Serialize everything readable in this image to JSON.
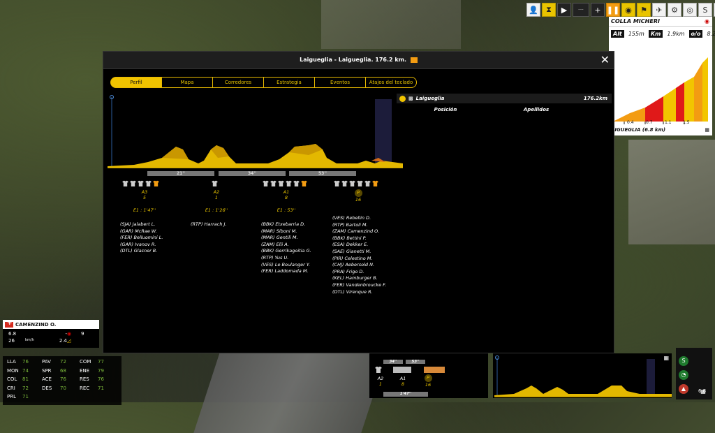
{
  "toolbar": {
    "icons": [
      "person-icon",
      "hourglass-icon",
      "play-icon",
      "fast-forward-icon",
      "plus-icon",
      "pause-icon",
      "eye-icon",
      "flag-icon",
      "bird-icon",
      "bicycle-icon",
      "stage-icon",
      "s-icon",
      "menu-icon",
      "info-icon"
    ],
    "dots": "····"
  },
  "mini_profile": {
    "title": "COLLA MICHERI",
    "alt_label": "Alt",
    "alt": "155m",
    "km_label": "Km",
    "km": "1.9km",
    "grade_label": "o/o",
    "grade": "8.2%",
    "ticks": [
      "0.4",
      "0.7",
      "1.1",
      "1.5"
    ],
    "bottom_label": "AIGUEGLIA (6.8 km)"
  },
  "modal": {
    "title": "Laigueglia - Laigueglia. 176.2 km.",
    "tabs": [
      "Perfil",
      "Mapa",
      "Corredores",
      "Estrategia",
      "Eventos",
      "Atajos del teclado"
    ],
    "active_tab": "Perfil",
    "segments": [
      {
        "label": "21''"
      },
      {
        "label": "34''"
      },
      {
        "label": "53''"
      }
    ],
    "groups": [
      {
        "climb": "A3",
        "count": "5",
        "gap": "E1 : 1'47''",
        "riders": [
          "(SJA) Jalabert L.",
          "(GAR) McRae W.",
          "(FER) Belluomini L.",
          "(GAR) Ivanov R.",
          "(DTL) Glasner B."
        ]
      },
      {
        "climb": "A2",
        "count": "1",
        "gap": "E1 : 1'26''",
        "riders": [
          "(RTP) Harrach J."
        ]
      },
      {
        "climb": "A1",
        "count": "8",
        "gap": "E1 : 53''",
        "riders": [
          "(BBK) Etxebarria D.",
          "(MAR) Siboni M.",
          "(MAR) Gentili M.",
          "(ZAM) Elli A.",
          "(BBK) Gerrikagoitia G.",
          "(RTP) Yus U.",
          "(VES) Le Boulanger Y.",
          "(FER) Laddomada M."
        ]
      },
      {
        "climb": "P",
        "count": "16",
        "gap": "",
        "riders": [
          "(VES) Rebellin D.",
          "(RTP) Bartoli M.",
          "(ZAM) Camenzind O.",
          "(BBK) Bettini P.",
          "(ESA) Dekker E.",
          "(SAE) Gianetti M.",
          "(PIR) Celestino M.",
          "(CHJ) Aebersold N.",
          "(PRA) Frigo D.",
          "(KEL) Hamburger B.",
          "(FER) Vandenbroucke F.",
          "(DTL) Virenque R."
        ]
      }
    ],
    "finish": {
      "name": "Laigueglia",
      "distance": "176.2km",
      "col_position": "Posición",
      "col_names": "Apellidos"
    }
  },
  "rider": {
    "name": "CAMENZIND O.",
    "speed1": "6.8",
    "dash1": "-",
    "val3": "9",
    "speed2": "26",
    "unit": "km/h",
    "grade": "2.4",
    "attributes": [
      [
        "LLA",
        "76",
        "PAV",
        "72",
        "COM",
        "77"
      ],
      [
        "MON",
        "74",
        "SPR",
        "68",
        "ENE",
        "79"
      ],
      [
        "COL",
        "81",
        "ACE",
        "76",
        "RES",
        "76"
      ],
      [
        "CRI",
        "72",
        "DES",
        "70",
        "REC",
        "71"
      ],
      [
        "PRL",
        "71",
        "",
        "",
        "",
        ""
      ]
    ]
  },
  "bottom_segments": {
    "gaps": [
      "34''",
      "53''"
    ],
    "groups": [
      {
        "climb": "A2",
        "count": "1"
      },
      {
        "climb": "A1",
        "count": "8"
      },
      {
        "climb": "P",
        "count": "16"
      }
    ],
    "bottom_gap": "1'47''"
  },
  "right_col": {
    "value": "6.8"
  },
  "colors": {
    "accent": "#f0c300",
    "orange": "#f39c12",
    "green": "#7dbb3b"
  }
}
